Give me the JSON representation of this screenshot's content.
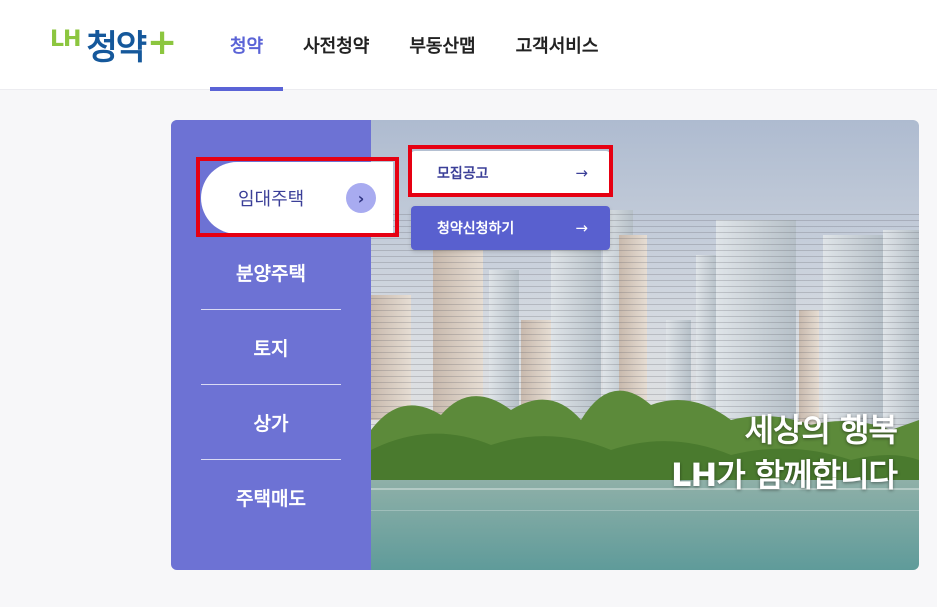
{
  "logo": {
    "lh": "LH",
    "main": "청약",
    "plus": "+"
  },
  "nav": [
    {
      "label": "청약",
      "active": true
    },
    {
      "label": "사전청약"
    },
    {
      "label": "부동산맵"
    },
    {
      "label": "고객서비스"
    }
  ],
  "sidebar": {
    "active_label": "임대주택",
    "active_arrow": "›",
    "items": [
      "분양주택",
      "토지",
      "상가",
      "주택매도"
    ]
  },
  "submenu": [
    {
      "label": "모집공고",
      "arrow": "→"
    },
    {
      "label": "청약신청하기",
      "arrow": "→"
    }
  ],
  "hero": {
    "line1": "세상의 행복",
    "line2": "LH가 함께합니다"
  },
  "colors": {
    "primary": "#5a63d6",
    "sidebar": "#6d72d4",
    "highlight": "#e60012",
    "logo_green": "#8cc63f",
    "logo_blue": "#15589b"
  }
}
